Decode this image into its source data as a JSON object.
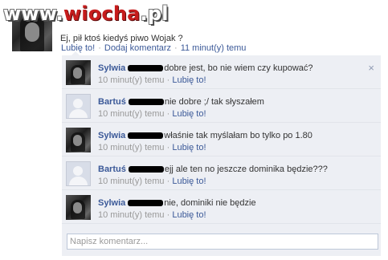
{
  "watermark": {
    "prefix": "www.",
    "brand": "wiocha",
    "suffix": ".pl"
  },
  "post": {
    "text": "Ej, pił ktoś kiedyś piwo Wojak ?",
    "like_label": "Lubię to!",
    "comment_label": "Dodaj komentarz",
    "time": "11 minut(y) temu",
    "separator": "·"
  },
  "comments": [
    {
      "author": "Sylwia",
      "text": "dobre jest, bo nie wiem czy kupować?",
      "time": "10 minut(y) temu",
      "like_label": "Lubię to!",
      "avatar": "female"
    },
    {
      "author": "Bartuś",
      "text": "nie dobre ;/ tak słyszałem",
      "time": "10 minut(y) temu",
      "like_label": "Lubię to!",
      "avatar": "default"
    },
    {
      "author": "Sylwia",
      "text": "właśnie tak myślałam bo tylko po 1.80",
      "time": "10 minut(y) temu",
      "like_label": "Lubię to!",
      "avatar": "female"
    },
    {
      "author": "Bartuś",
      "text": "ejj ale ten no jeszcze dominika będzie???",
      "time": "10 minut(y) temu",
      "like_label": "Lubię to!",
      "avatar": "default"
    },
    {
      "author": "Sylwia",
      "text": "nie, dominiki nie będzie",
      "time": "10 minut(y) temu",
      "like_label": "Lubię to!",
      "avatar": "female"
    }
  ],
  "meta_separator": "·",
  "close_icon": "×",
  "comment_input": {
    "placeholder": "Napisz komentarz..."
  },
  "colors": {
    "link": "#3b5998",
    "comment_bg": "#edeff4",
    "watermark_accent": "#c61c1c"
  }
}
